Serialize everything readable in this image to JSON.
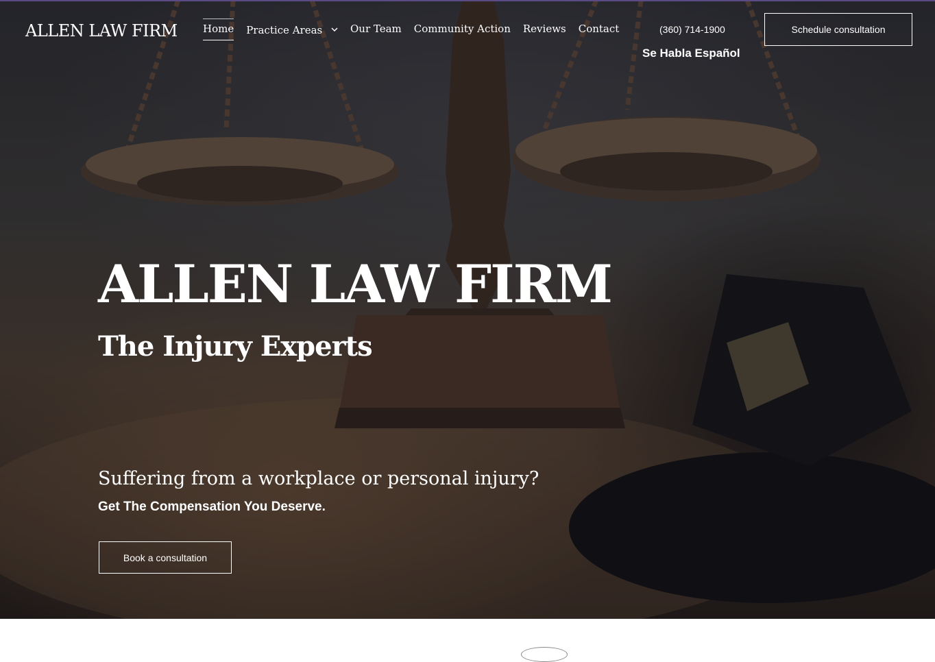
{
  "header": {
    "logo": "ALLEN LAW FIRM",
    "nav": [
      {
        "label": "Home",
        "active": true
      },
      {
        "label": "Practice Areas",
        "has_dropdown": true
      },
      {
        "label": "Our Team"
      },
      {
        "label": "Community Action"
      },
      {
        "label": "Reviews"
      },
      {
        "label": "Contact"
      }
    ],
    "phone": "(360) 714-1900",
    "language_note": "Se Habla Español",
    "cta_label": "Schedule consultation"
  },
  "hero": {
    "title": "ALLEN LAW FIRM",
    "subtitle": "The Injury Experts",
    "question": "Suffering from a workplace or personal injury?",
    "tagline": "Get The Compensation You Deserve.",
    "cta_label": "Book a consultation",
    "background_image": "scales-of-justice-and-gavel-photo"
  },
  "icons": {
    "dropdown": "chevron-down-icon"
  },
  "colors": {
    "text": "#ffffff",
    "accent_line": "#5a4b86",
    "page_background": "#ffffff"
  }
}
